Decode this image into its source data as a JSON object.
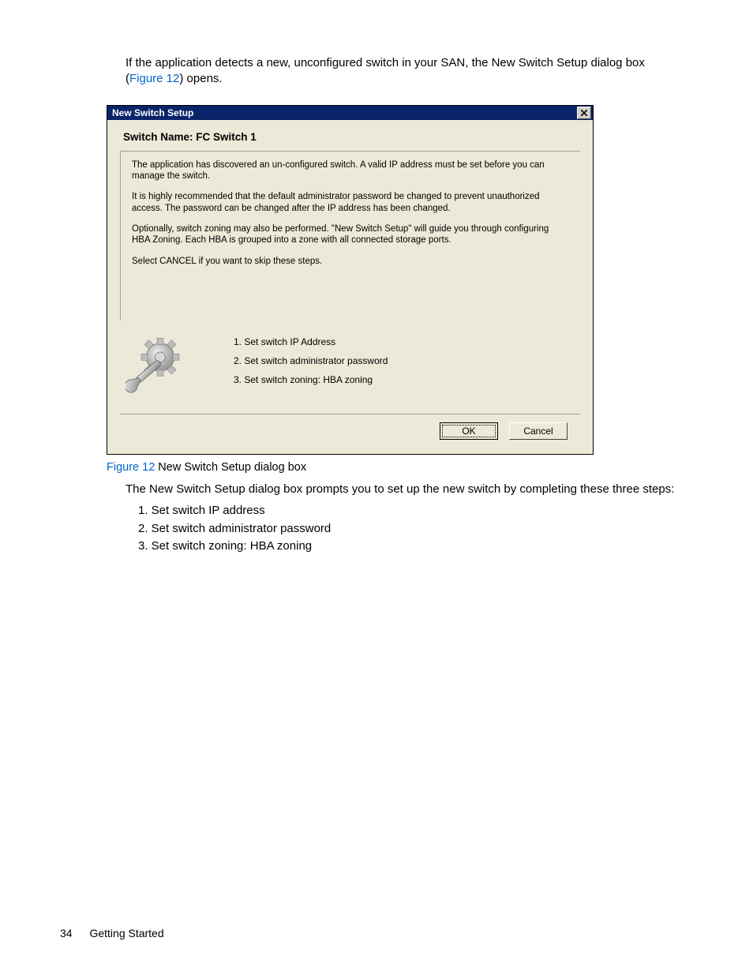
{
  "intro": {
    "pre": "If the application detects a new, unconfigured switch in your SAN, the New Switch Setup dialog box (",
    "link": "Figure 12",
    "post": ") opens."
  },
  "dialog": {
    "title": "New Switch Setup",
    "switchNameLabel": "Switch Name: FC Switch 1",
    "para1": "The application has discovered an un-configured switch. A valid IP address must be set before you can manage the switch.",
    "para2": "It is highly recommended that the default administrator password be changed to prevent unauthorized access.  The password can be changed after the IP address has been changed.",
    "para3": "Optionally, switch zoning may also be performed.  \"New Switch Setup\" will guide you through configuring HBA Zoning.  Each HBA is grouped into a zone with all connected storage ports.",
    "para4": "Select CANCEL if you want to skip these steps.",
    "step1": "1. Set switch IP Address",
    "step2": "2. Set switch administrator password",
    "step3": "3. Set switch zoning: HBA zoning",
    "okLabel": "OK",
    "cancelLabel": "Cancel"
  },
  "caption": {
    "label": "Figure 12",
    "text": " New Switch Setup dialog box"
  },
  "afterText": "The New Switch Setup dialog box prompts you to set up the new switch by completing these three steps:",
  "docSteps": {
    "s1": "1. Set switch IP address",
    "s2": "2. Set switch administrator password",
    "s3": "3. Set switch zoning: HBA zoning"
  },
  "footer": {
    "page": "34",
    "section": "Getting Started"
  }
}
